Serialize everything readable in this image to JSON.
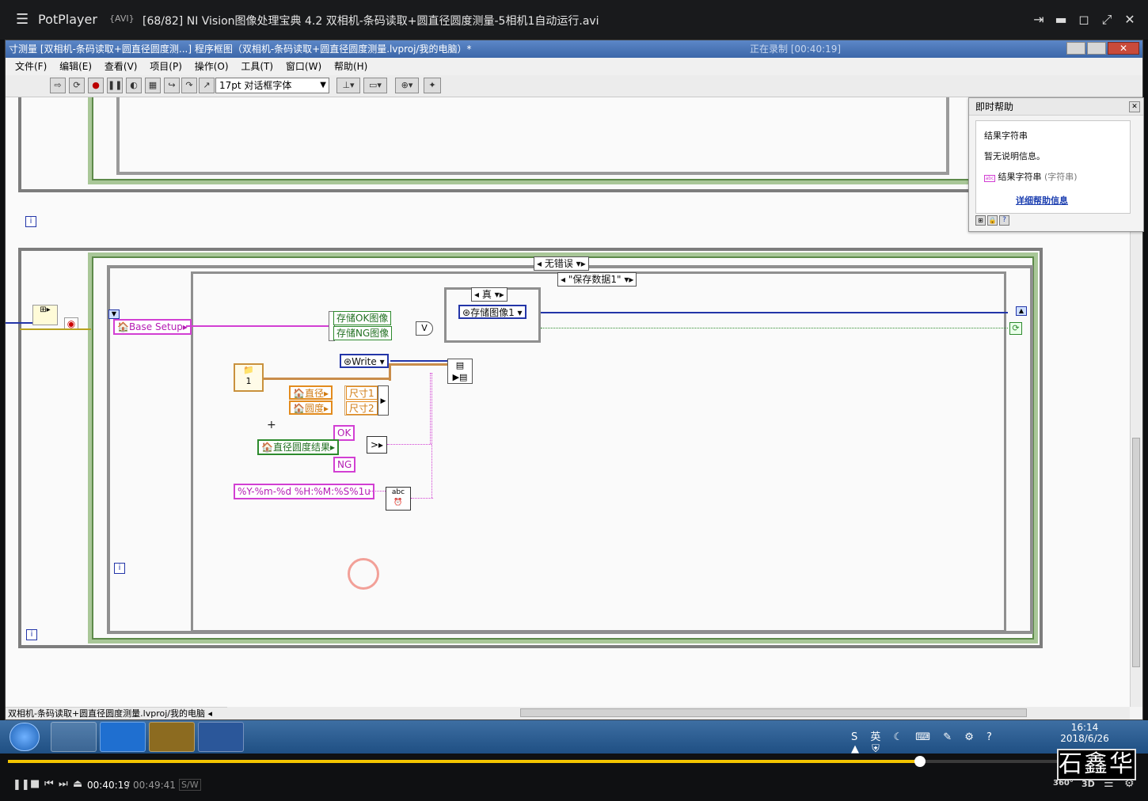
{
  "player": {
    "app_name": "PotPlayer",
    "format_badge": "{AVI}",
    "file_title": "[68/82] NI Vision图像处理宝典 4.2 双相机-条码读取+圆直径圆度测量-5相机1自动运行.avi",
    "current_time": "00:40:19",
    "separator": "/",
    "total_time": "00:49:41",
    "sw_label": "S/W",
    "progress": 0.8116,
    "badges": [
      "360°",
      "3D"
    ]
  },
  "lv": {
    "window_title": "寸测量 [双相机-条码读取+圆直径圆度测...] 程序框图（双相机-条码读取+圆直径圆度测量.lvproj/我的电脑）*",
    "recording_text": "正在录制 [00:40:19]",
    "menu": [
      "文件(F)",
      "编辑(E)",
      "查看(V)",
      "项目(P)",
      "操作(O)",
      "工具(T)",
      "窗口(W)",
      "帮助(H)"
    ],
    "font_selector": "17pt 对话框字体",
    "status_path": "双相机-条码读取+圆直径圆度测量.lvproj/我的电脑",
    "help": {
      "title": "即时帮助",
      "heading": "结果字符串",
      "desc": "暂无说明信息。",
      "term_type_line": "结果字符串",
      "term_type_suffix": "(字符串)",
      "link": "详细帮助信息"
    },
    "diagram": {
      "case_no_error": "无错误",
      "case_save": "\"保存数据1\"",
      "case_true": "真",
      "base_setup": "Base Setup",
      "ok_image": "存储OK图像",
      "ng_image": "存储NG图像",
      "save_image": "存储图像1",
      "write": "Write",
      "diameter": "直径",
      "roundness": "圆度",
      "size1": "尺寸1",
      "size2": "尺寸2",
      "ok": "OK",
      "ng": "NG",
      "result": "直径圆度结果",
      "format_string": "%Y-%m-%d %H:%M:%S%1u",
      "iter_i": "i",
      "num_1": "1"
    }
  },
  "taskbar": {
    "time": "16:14",
    "date": "2018/6/26"
  },
  "watermark_stamp": "石鑫华",
  "colors": {
    "seek": "#f2c400",
    "pink": "#d23fd3",
    "orange": "#e38b1d",
    "green": "#2d8a2d",
    "blue": "#2335a8"
  }
}
